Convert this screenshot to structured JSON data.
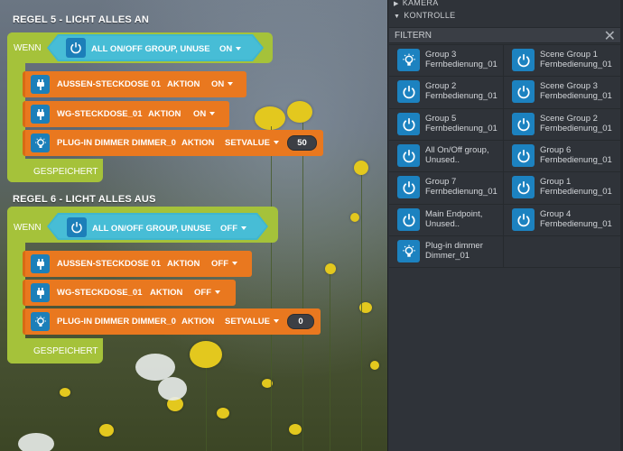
{
  "rules": [
    {
      "title": "REGEL 5 - LICHT ALLES AN",
      "when_label": "WENN",
      "condition": {
        "icon": "power-icon",
        "text": "ALL ON/OFF GROUP, UNUSE",
        "state": "ON"
      },
      "actions": [
        {
          "icon": "plug-icon",
          "device": "AUSSEN-STECKDOSE 01",
          "action_label": "AKTION",
          "value": "ON"
        },
        {
          "icon": "plug-icon",
          "device": "WG-STECKDOSE_01",
          "action_label": "AKTION",
          "value": "ON"
        },
        {
          "icon": "bulb-icon",
          "device": "PLUG-IN DIMMER DIMMER_0",
          "action_label": "AKTION",
          "value": "SETVALUE",
          "number": "50"
        }
      ],
      "saved_label": "GESPEICHERT"
    },
    {
      "title": "REGEL 6 - LICHT ALLES AUS",
      "when_label": "WENN",
      "condition": {
        "icon": "power-icon",
        "text": "ALL ON/OFF GROUP, UNUSE",
        "state": "OFF"
      },
      "actions": [
        {
          "icon": "plug-icon",
          "device": "AUSSEN-STECKDOSE 01",
          "action_label": "AKTION",
          "value": "OFF"
        },
        {
          "icon": "plug-icon",
          "device": "WG-STECKDOSE_01",
          "action_label": "AKTION",
          "value": "OFF"
        },
        {
          "icon": "bulb-icon",
          "device": "PLUG-IN DIMMER DIMMER_0",
          "action_label": "AKTION",
          "value": "SETVALUE",
          "number": "0"
        }
      ],
      "saved_label": "GESPEICHERT"
    }
  ],
  "panel": {
    "sections": [
      "KAMERA",
      "KONTROLLE"
    ],
    "filter_label": "FILTERN",
    "close_symbol": "✕",
    "devices": [
      {
        "icon": "bulb-icon",
        "line1": "Group 3",
        "line2": "Fernbedienung_01"
      },
      {
        "icon": "power-icon",
        "line1": "Scene Group 1",
        "line2": "Fernbedienung_01"
      },
      {
        "icon": "power-icon",
        "line1": "Group 2",
        "line2": "Fernbedienung_01"
      },
      {
        "icon": "power-icon",
        "line1": "Scene Group 3",
        "line2": "Fernbedienung_01"
      },
      {
        "icon": "power-icon",
        "line1": "Group 5",
        "line2": "Fernbedienung_01"
      },
      {
        "icon": "power-icon",
        "line1": "Scene Group 2",
        "line2": "Fernbedienung_01"
      },
      {
        "icon": "power-icon",
        "line1": "All On/Off group,",
        "line2": "Unused.."
      },
      {
        "icon": "power-icon",
        "line1": "Group 6",
        "line2": "Fernbedienung_01"
      },
      {
        "icon": "power-icon",
        "line1": "Group 7",
        "line2": "Fernbedienung_01"
      },
      {
        "icon": "power-icon",
        "line1": "Group 1",
        "line2": "Fernbedienung_01"
      },
      {
        "icon": "power-icon",
        "line1": "Main Endpoint,",
        "line2": "Unused.."
      },
      {
        "icon": "power-icon",
        "line1": "Group 4",
        "line2": "Fernbedienung_01"
      },
      {
        "icon": "bulb-icon",
        "line1": "Plug-in dimmer",
        "line2": "Dimmer_01"
      }
    ]
  },
  "colors": {
    "rule_green": "#a5c23a",
    "condition_cyan": "#47bdd6",
    "action_orange": "#e9781f",
    "icon_blue": "#1c7fb9",
    "panel_bg": "#2f3339"
  }
}
